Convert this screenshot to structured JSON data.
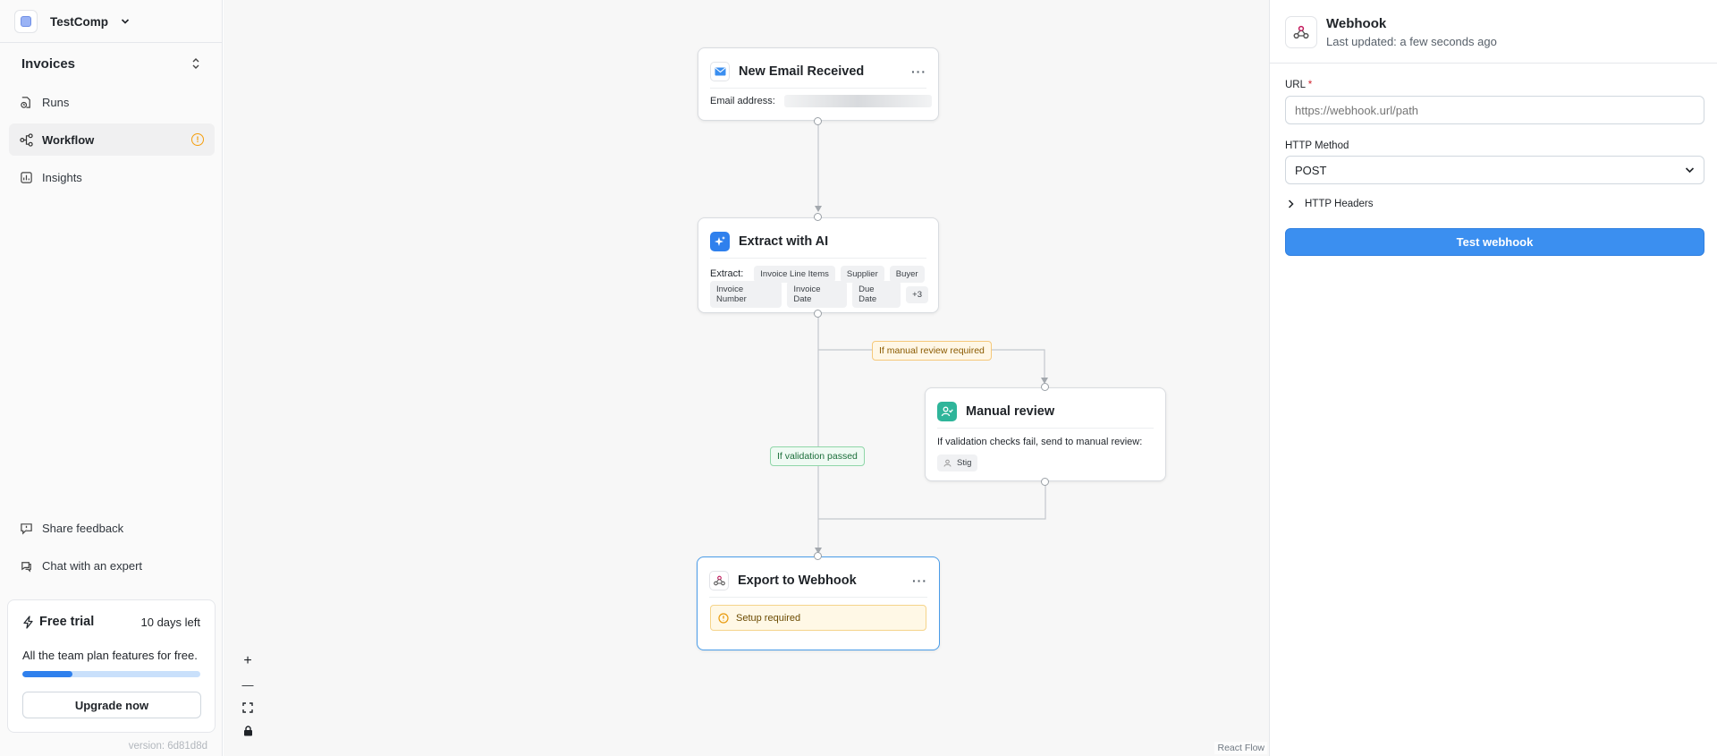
{
  "sidebar": {
    "company": "TestComp",
    "section_title": "Invoices",
    "nav": [
      {
        "label": "Runs",
        "icon": "runs-icon"
      },
      {
        "label": "Workflow",
        "icon": "workflow-icon",
        "badge": "!"
      },
      {
        "label": "Insights",
        "icon": "insights-icon"
      }
    ],
    "footer_links": [
      {
        "label": "Share feedback",
        "icon": "feedback-icon"
      },
      {
        "label": "Chat with an expert",
        "icon": "chat-icon"
      }
    ],
    "trial": {
      "title": "Free trial",
      "days_left": "10 days left",
      "description": "All the team plan features for free.",
      "progress": 0.28,
      "button": "Upgrade now"
    },
    "version": "version: 6d81d8d"
  },
  "canvas": {
    "nodes": {
      "email": {
        "title": "New Email Received",
        "field_label": "Email address:",
        "more": "···"
      },
      "extract": {
        "title": "Extract with AI",
        "field_label": "Extract:",
        "chips": [
          "Invoice Line Items",
          "Supplier",
          "Buyer",
          "Invoice Number",
          "Invoice Date",
          "Due Date",
          "+3"
        ]
      },
      "review": {
        "title": "Manual review",
        "description": "If validation checks fail, send to manual review:",
        "assignee": "Stig"
      },
      "export": {
        "title": "Export to Webhook",
        "more": "···",
        "warning": "Setup required"
      }
    },
    "edge_labels": {
      "manual": "If manual review required",
      "validation": "If validation passed"
    },
    "controls": {
      "zoom_in": "+",
      "zoom_out": "—"
    },
    "attribution": "React Flow"
  },
  "panel": {
    "title": "Webhook",
    "subtitle": "Last updated: a few seconds ago",
    "url_label": "URL",
    "url_required": "*",
    "url_placeholder": "https://webhook.url/path",
    "method_label": "HTTP Method",
    "method_value": "POST",
    "headers_label": "HTTP Headers",
    "test_button": "Test webhook"
  },
  "colors": {
    "accent": "#3b8ff0",
    "warning": "#f59e0b",
    "ai_icon": "#2f80ed",
    "review_icon": "#2fb59a"
  }
}
